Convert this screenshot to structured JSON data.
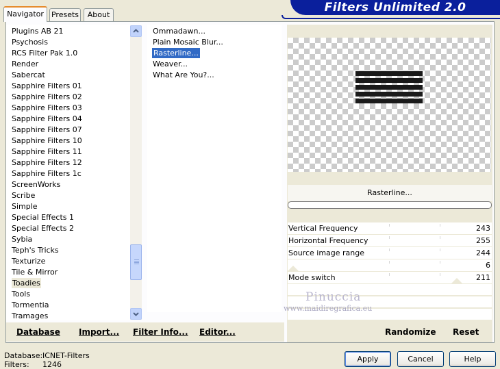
{
  "tabs": [
    {
      "label": "Navigator",
      "active": true
    },
    {
      "label": "Presets",
      "active": false
    },
    {
      "label": "About",
      "active": false
    }
  ],
  "banner": {
    "title": "Filters Unlimited 2.0"
  },
  "categories": [
    "Plugins AB 21",
    "Psychosis",
    "RCS Filter Pak 1.0",
    "Render",
    "Sabercat",
    "Sapphire Filters 01",
    "Sapphire Filters 02",
    "Sapphire Filters 03",
    "Sapphire Filters 04",
    "Sapphire Filters 07",
    "Sapphire Filters 10",
    "Sapphire Filters 11",
    "Sapphire Filters 12",
    "Sapphire Filters 1c",
    "ScreenWorks",
    "Scribe",
    "Simple",
    "Special Effects 1",
    "Special Effects 2",
    "Sybia",
    "Teph's Tricks",
    "Texturize",
    "Tile & Mirror",
    "Toadies",
    "Tools",
    "Tormentia",
    "Tramages"
  ],
  "selected_category": "Toadies",
  "filters": [
    "Ommadawn...",
    "Plain Mosaic Blur...",
    "Rasterline...",
    "Weaver...",
    "What Are You?..."
  ],
  "selected_filter": "Rasterline...",
  "preview": {
    "filter_name": "Rasterline..."
  },
  "parameters": [
    {
      "label": "Vertical Frequency",
      "value": "243"
    },
    {
      "label": "Horizontal Frequency",
      "value": "255"
    },
    {
      "label": "Source image range",
      "value": "244"
    },
    {
      "label": "",
      "value": "6"
    },
    {
      "label": "Mode switch",
      "value": "211"
    }
  ],
  "watermark": {
    "name": "Pinuccia",
    "site": "www.maidiregrafica.eu"
  },
  "toolbar": {
    "database": "Database",
    "import": "Import...",
    "filter_info": "Filter Info...",
    "editor": "Editor...",
    "randomize": "Randomize",
    "reset": "Reset"
  },
  "status": {
    "database_label": "Database:",
    "database_value": "ICNET-Filters",
    "filters_label": "Filters:",
    "filters_value": "1246"
  },
  "buttons": {
    "apply": "Apply",
    "cancel": "Cancel",
    "help": "Help"
  }
}
